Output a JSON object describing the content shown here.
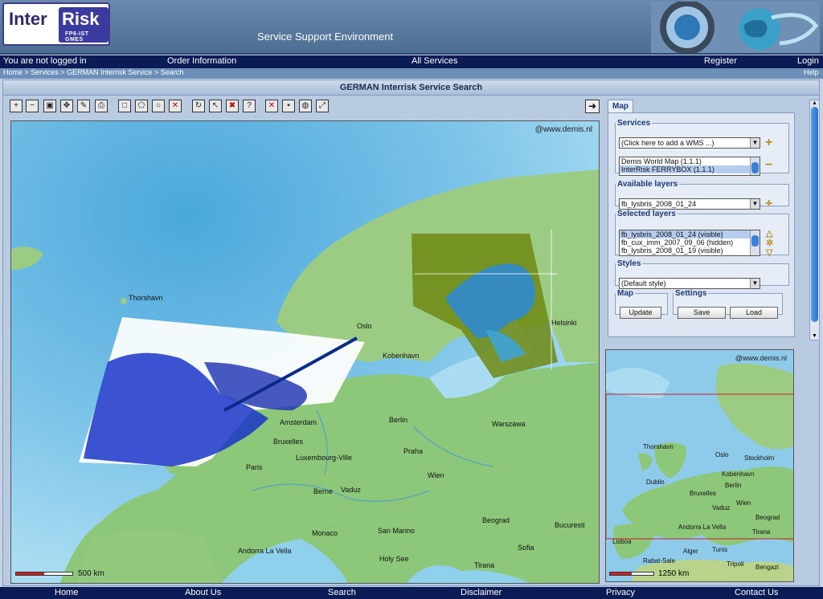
{
  "header": {
    "logo_inter": "Inter",
    "logo_risk": "Risk",
    "logo_sub": "FP6-IST GMES",
    "title": "Service Support Environment"
  },
  "topnav": {
    "login_status": "You are not logged in",
    "order_info": "Order Information",
    "all_services": "All Services",
    "register": "Register",
    "login": "Login"
  },
  "breadcrumb": {
    "path": "Home > Services > GERMAN Interrisk Service > Search",
    "help": "Help"
  },
  "panel": {
    "title": "GERMAN Interrisk Service Search"
  },
  "toolbar": {
    "tools": [
      "zoom-in",
      "zoom-out",
      "zoom-box",
      "pan",
      "identify",
      "print",
      "rectangle",
      "polygon",
      "circle",
      "clear-shape",
      "refresh",
      "select",
      "delete",
      "query",
      "remove",
      "save",
      "globe",
      "extent"
    ],
    "toggle_icon": "arrow-right"
  },
  "map": {
    "credit": "@www.demis.nl",
    "scale_label": "500 km",
    "places": [
      "Thorshavn",
      "Oslo",
      "Kobenhavn",
      "Berlin",
      "Warszawa",
      "Amsterdam",
      "Bruxelles",
      "Luxembourg-Ville",
      "Praha",
      "Paris",
      "Wien",
      "Berne",
      "Vaduz",
      "Monaco",
      "San Marino",
      "Beograd",
      "Bucuresti",
      "Sofia",
      "Andorra La Vella",
      "Holy See",
      "Tirana",
      "Helsinki"
    ],
    "water": "#8ecbea",
    "land": "#8cc77a"
  },
  "sidebar": {
    "tab": "Map",
    "services": {
      "legend": "Services",
      "select_value": "(Click here to add a WMS ...)",
      "items": [
        "Demis World Map (1.1.1)",
        "InterRisk FERRYBOX (1.1.1)"
      ]
    },
    "available_layers": {
      "legend": "Available layers",
      "select_value": "fb_lysbris_2008_01_24"
    },
    "selected_layers": {
      "legend": "Selected layers",
      "items": [
        "fb_lysbris_2008_01_24 (visible)",
        "fb_cux_imm_2007_09_06 (hidden)",
        "fb_lysbris_2008_01_19 (visible)"
      ]
    },
    "styles": {
      "legend": "Styles",
      "select_value": "(Default style)"
    },
    "map_group": {
      "legend": "Map",
      "update": "Update"
    },
    "settings_group": {
      "legend": "Settings",
      "save": "Save",
      "load": "Load"
    }
  },
  "minimap": {
    "credit": "@www.demis.nl",
    "scale_label": "1250 km",
    "places": [
      "Thorshavn",
      "Oslo",
      "Stockholm",
      "Kobenhavn",
      "Dublin",
      "Berlin",
      "Bruxelles",
      "Wien",
      "Vaduz",
      "Beograd",
      "Andorra La Vella",
      "Tirana",
      "Lisboa",
      "Alger",
      "Tunis",
      "Rabat-Sale",
      "Tripoli",
      "Bengazi"
    ]
  },
  "footer": {
    "home": "Home",
    "about": "About Us",
    "search": "Search",
    "disclaimer": "Disclaimer",
    "privacy": "Privacy",
    "contact": "Contact Us"
  }
}
